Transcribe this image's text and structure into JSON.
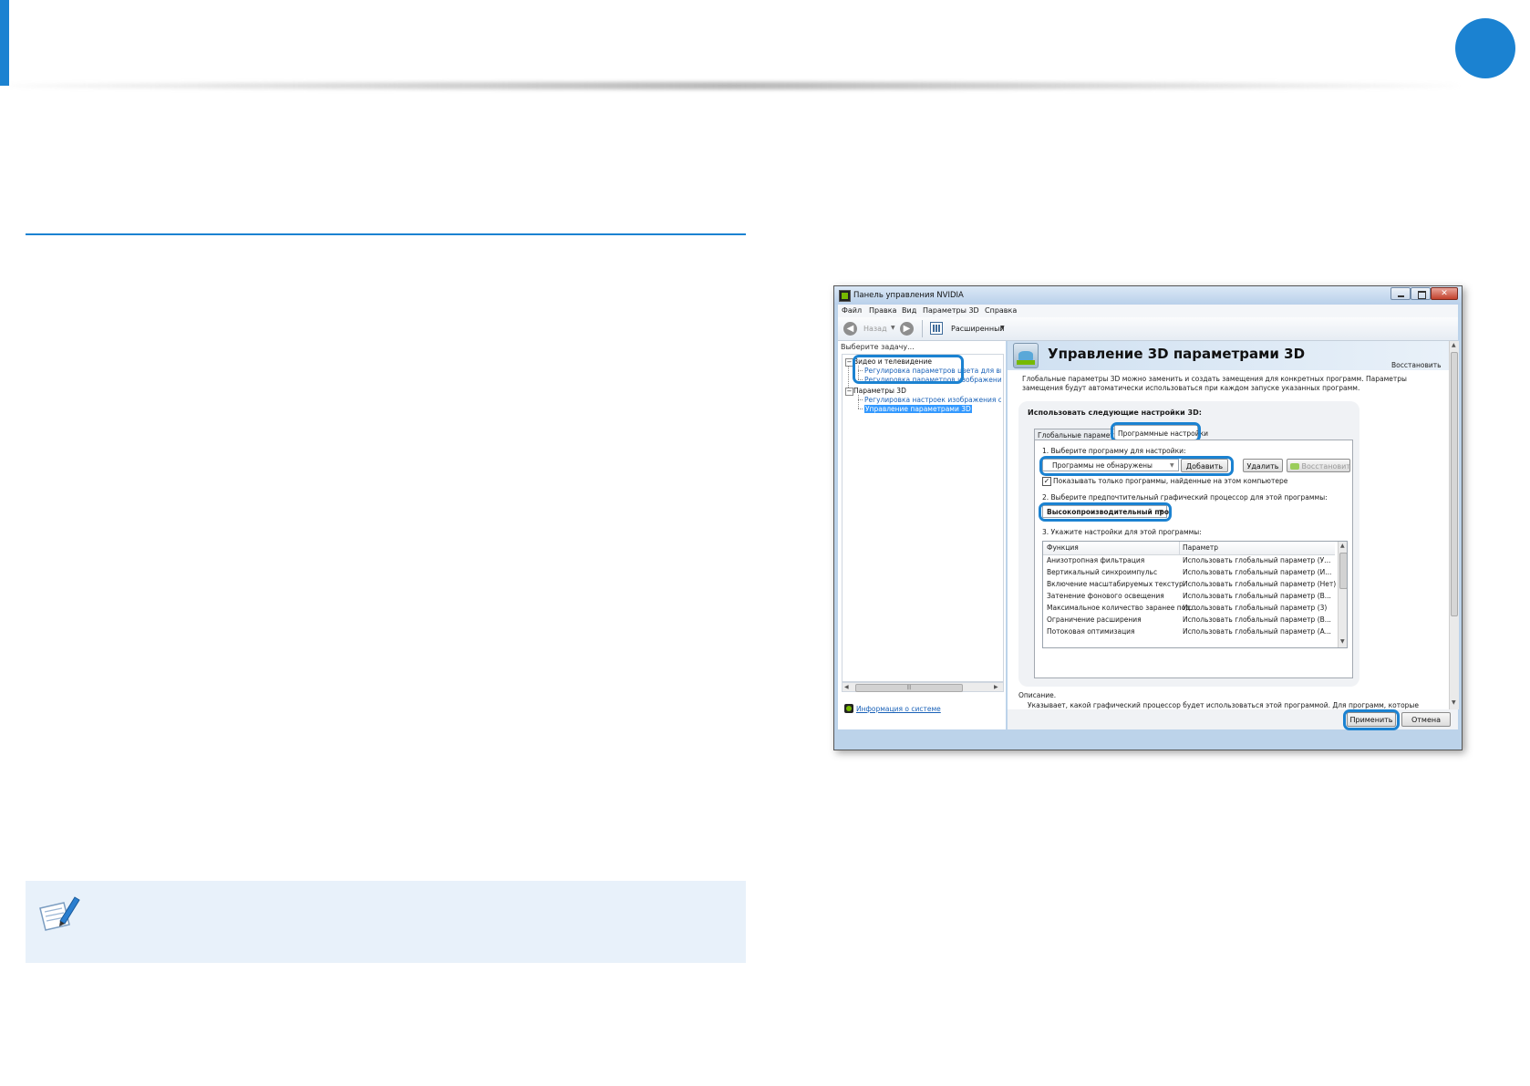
{
  "window": {
    "title": "Панель управления NVIDIA",
    "menu": [
      "Файл",
      "Правка",
      "Вид",
      "Параметры 3D",
      "Справка"
    ],
    "toolbar": {
      "back_label": "Назад",
      "view_label": "Расширенный"
    }
  },
  "left_panel": {
    "header": "Выберите задачу...",
    "groups": [
      {
        "label": "Видео и телевидение",
        "items": [
          "Регулировка параметров цвета для видео",
          "Регулировка параметров изображения для видео"
        ]
      },
      {
        "label": "Параметры 3D",
        "items": [
          "Регулировка настроек изображения с просмотром",
          "Управление параметрами 3D"
        ]
      }
    ],
    "system_info_link": "Информация о системе"
  },
  "main": {
    "title": "Управление 3D параметрами 3D",
    "restore_link": "Восстановить",
    "description": "Глобальные параметры 3D можно заменить и создать замещения для конкретных программ. Параметры замещения будут автоматически использоваться при каждом запуске указанных программ.",
    "settings_heading": "Использовать следующие настройки 3D:",
    "tabs": [
      "Глобальные параметры",
      "Программные настройки"
    ],
    "step1_label": "1. Выберите программу для настройки:",
    "program_dropdown_value": "Программы не обнаружены",
    "add_button": "Добавить",
    "remove_button": "Удалить",
    "restore_button": "Восстановить",
    "checkbox_label": "Показывать только программы, найденные на этом компьютере",
    "step2_label": "2. Выберите предпочтительный графический процессор для этой программы:",
    "gpu_dropdown_value": "Высокопроизводительный про",
    "step3_label": "3. Укажите настройки для этой программы:",
    "table": {
      "headers": [
        "Функция",
        "Параметр"
      ],
      "rows": [
        [
          "Анизотропная фильтрация",
          "Использовать глобальный параметр (У..."
        ],
        [
          "Вертикальный синхроимпульс",
          "Использовать глобальный параметр (И..."
        ],
        [
          "Включение масштабируемых текстур",
          "Использовать глобальный параметр (Нет)"
        ],
        [
          "Затенение фонового освещения",
          "Использовать глобальный параметр (В..."
        ],
        [
          "Максимальное количество заранее под...",
          "Использовать глобальный параметр (3)"
        ],
        [
          "Ограничение расширения",
          "Использовать глобальный параметр (В..."
        ],
        [
          "Потоковая оптимизация",
          "Использовать глобальный параметр (А..."
        ]
      ]
    },
    "description_label": "Описание.",
    "description_text": "Указывает, какой графический процессор будет использоваться этой программой. Для программ, которые",
    "apply_button": "Применить",
    "cancel_button": "Отмена"
  },
  "colors": {
    "accent": "#1b82d1",
    "note_bg": "#e8f1fa",
    "window_frame": "#8fb3d6"
  }
}
